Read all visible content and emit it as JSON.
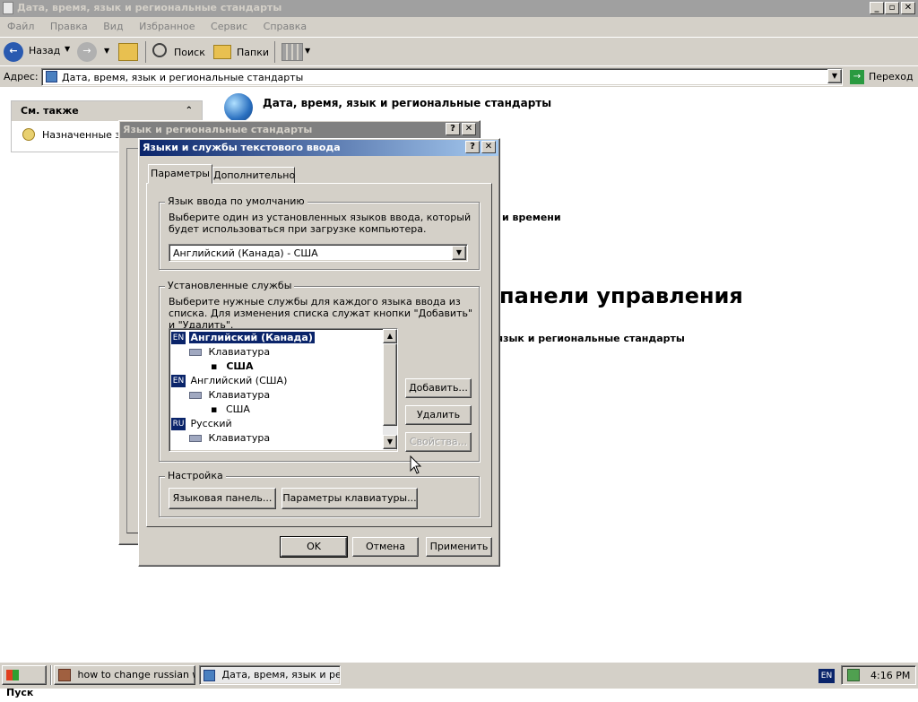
{
  "window": {
    "title": "Дата, время, язык и региональные стандарты"
  },
  "menu": [
    "Файл",
    "Правка",
    "Вид",
    "Избранное",
    "Сервис",
    "Справка"
  ],
  "toolbar": {
    "back": "Назад",
    "search": "Поиск",
    "folders": "Папки"
  },
  "address": {
    "label": "Адрес:",
    "value": "Дата, время, язык и региональные стандарты",
    "go": "Переход"
  },
  "see_also": {
    "title": "См. также",
    "item": "Назначенные за"
  },
  "main": {
    "heading": "Дата, время, язык и региональные стандарты",
    "frag1": "и времени",
    "frag2": "панели управления",
    "frag3": "язык и региональные стандарты"
  },
  "dialog1": {
    "title": "Язык и региональные стандарты"
  },
  "dialog2": {
    "title": "Языки и службы текстового ввода",
    "tabs": [
      "Параметры",
      "Дополнительно"
    ],
    "default_group": {
      "label": "Язык ввода по умолчанию",
      "desc": "Выберите один из установленных языков ввода, который будет использоваться при загрузке компьютера.",
      "selected": "Английский (Канада) - США"
    },
    "services_group": {
      "label": "Установленные службы",
      "desc": "Выберите нужные службы для каждого языка ввода из списка. Для изменения списка служат кнопки \"Добавить\" и \"Удалить\"."
    },
    "tree": [
      {
        "flag": "EN",
        "text": "Английский (Канада)"
      },
      {
        "text": "Клавиатура"
      },
      {
        "text": "США"
      },
      {
        "flag": "EN",
        "text": "Английский (США)"
      },
      {
        "text": "Клавиатура"
      },
      {
        "text": "США"
      },
      {
        "flag": "RU",
        "text": "Русский"
      },
      {
        "text": "Клавиатура"
      }
    ],
    "buttons": {
      "add": "Добавить...",
      "remove": "Удалить",
      "props": "Свойства..."
    },
    "settings_group": {
      "label": "Настройка",
      "langbar": "Языковая панель...",
      "keyparams": "Параметры клавиатуры..."
    },
    "footer": {
      "ok": "OK",
      "cancel": "Отмена",
      "apply": "Применить"
    }
  },
  "taskbar": {
    "start": "Пуск",
    "task1": "how to change russian w...",
    "task2": "Дата, время, язык и ре...",
    "lang": "EN",
    "time": "4:16 PM"
  }
}
